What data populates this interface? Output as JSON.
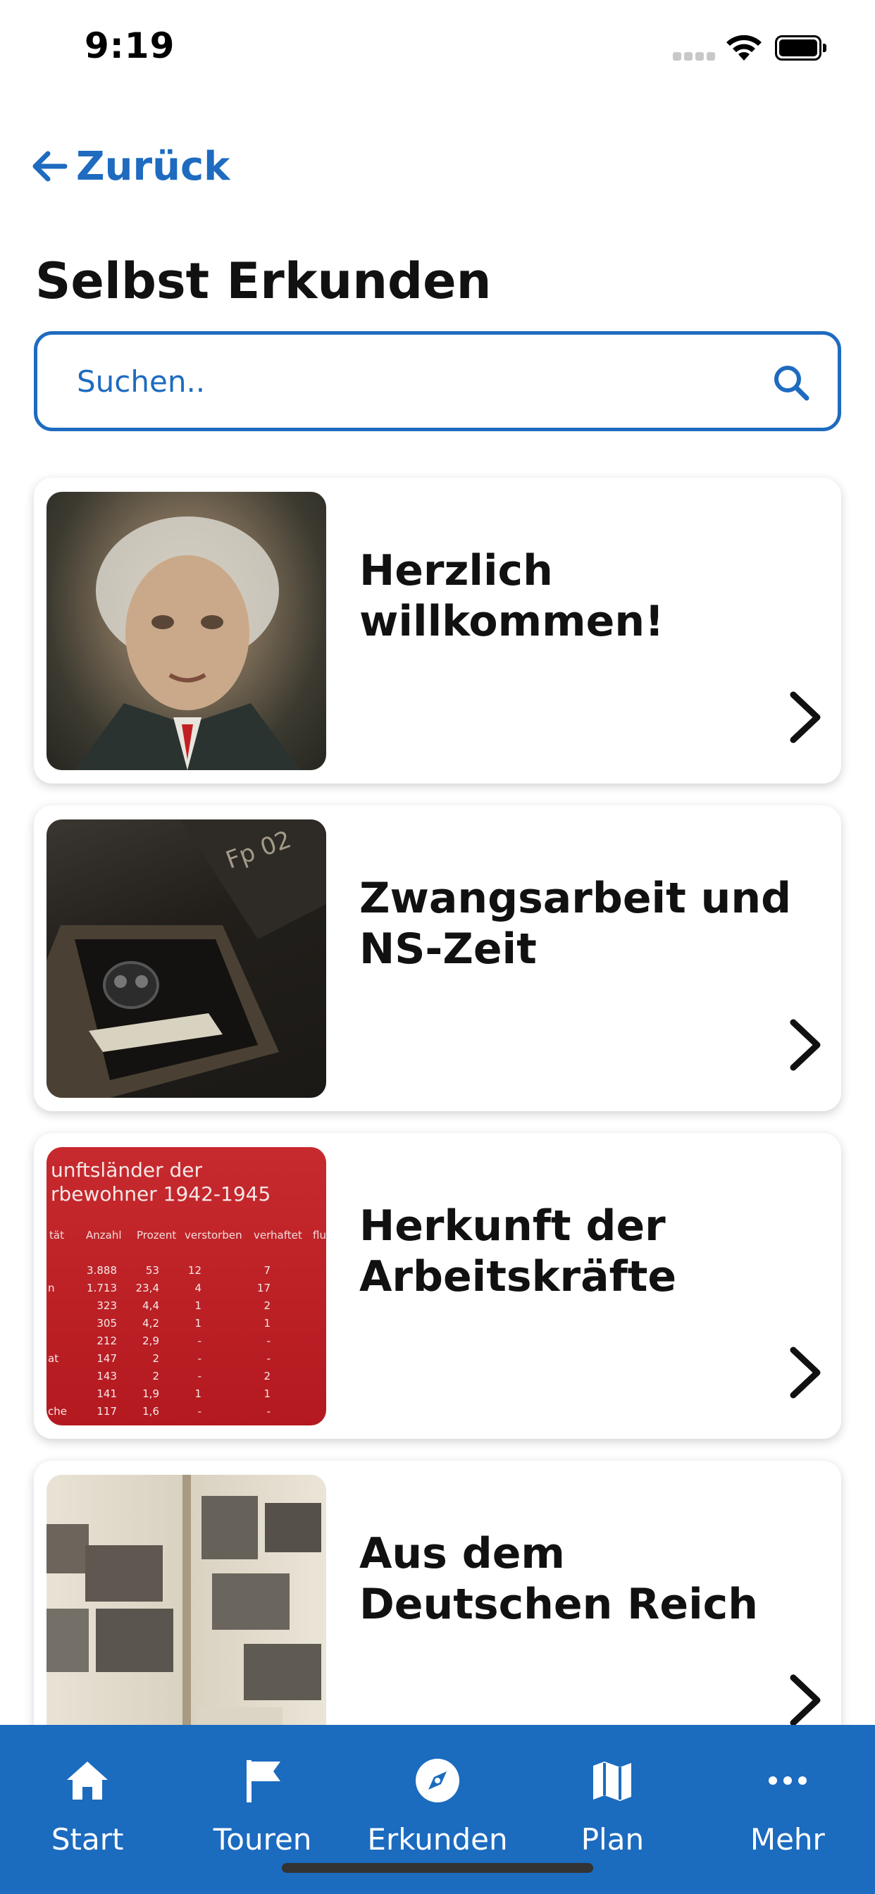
{
  "status_bar": {
    "time": "9:19"
  },
  "nav": {
    "back_label": "Zurück"
  },
  "page": {
    "title": "Selbst Erkunden"
  },
  "search": {
    "placeholder": "Suchen.."
  },
  "cards": [
    {
      "title": "Herzlich willkommen!",
      "image": "portrait-painting"
    },
    {
      "title": "Zwangsarbeit und NS-Zeit",
      "image": "box-with-gas-mask"
    },
    {
      "title": "Herkunft der Arbeitskräfte",
      "image": "statistics-table"
    },
    {
      "title": "Aus dem Deutschen Reich",
      "image": "photo-album"
    }
  ],
  "card_table_image": {
    "heading_line1": "unftsländer der",
    "heading_line2": "rbewohner 1942-1945",
    "columns": [
      "tät",
      "Anzahl",
      "Prozent",
      "verstorben",
      "verhaftet",
      "flu"
    ],
    "rows": [
      [
        "",
        "3.888",
        "53",
        "12",
        "7"
      ],
      [
        "n",
        "1.713",
        "23,4",
        "4",
        "17"
      ],
      [
        "",
        "323",
        "4,4",
        "1",
        "2"
      ],
      [
        "",
        "305",
        "4,2",
        "1",
        "1"
      ],
      [
        "",
        "212",
        "2,9",
        "-",
        "-"
      ],
      [
        "at",
        "147",
        "2",
        "-",
        "-"
      ],
      [
        "",
        "143",
        "2",
        "-",
        "2"
      ],
      [
        "",
        "141",
        "1,9",
        "1",
        "1"
      ],
      [
        "che",
        "117",
        "1,6",
        "-",
        "-"
      ]
    ]
  },
  "tab_bar": {
    "accent": "#1b6bbf",
    "tabs": [
      {
        "label": "Start",
        "icon": "home-icon"
      },
      {
        "label": "Touren",
        "icon": "flag-icon"
      },
      {
        "label": "Erkunden",
        "icon": "compass-icon"
      },
      {
        "label": "Plan",
        "icon": "map-icon"
      },
      {
        "label": "Mehr",
        "icon": "more-icon"
      }
    ]
  },
  "colors": {
    "primary": "#1e6bc0",
    "text": "#111111"
  }
}
